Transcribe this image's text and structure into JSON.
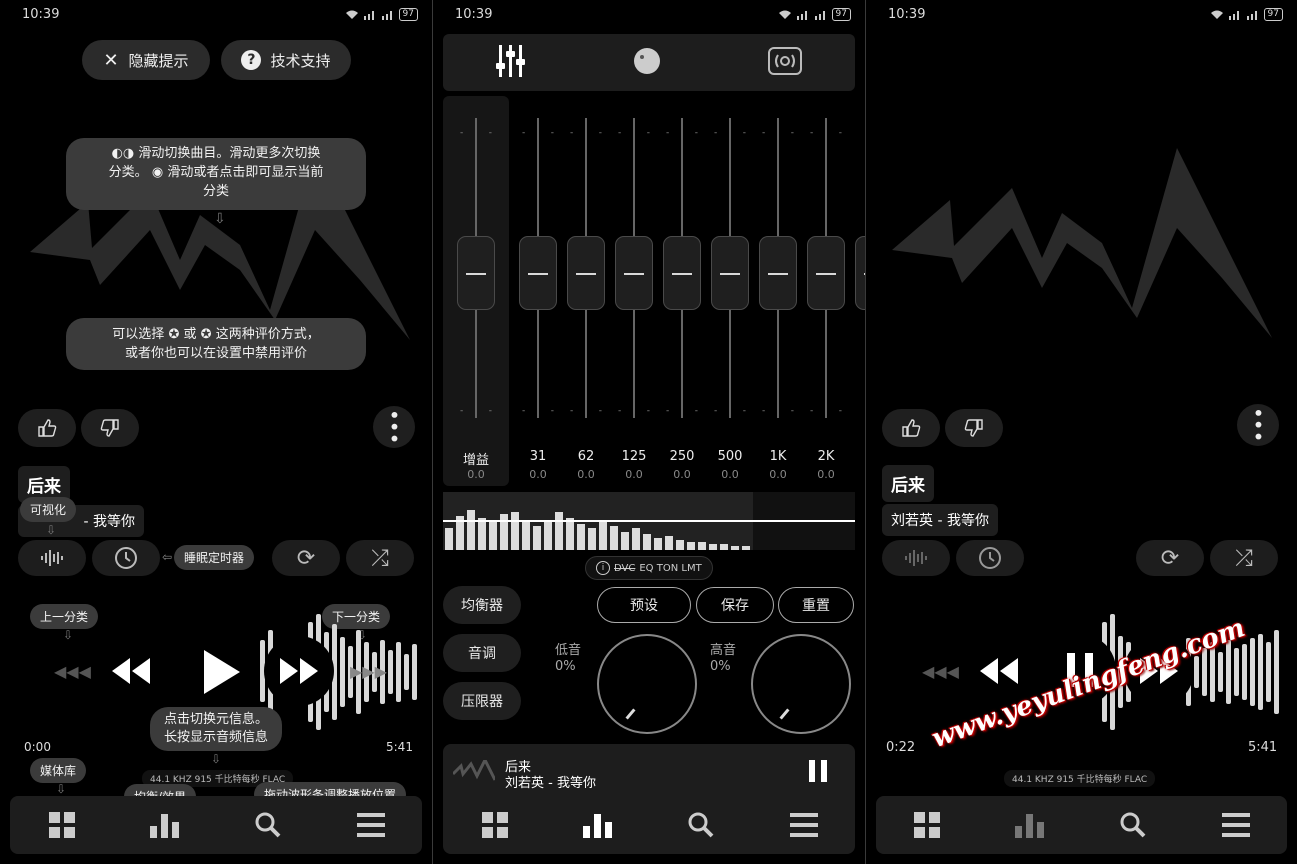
{
  "status": {
    "time": "10:39",
    "battery": "97",
    "net1": "4G",
    "net2": "2G"
  },
  "track": {
    "title": "后来",
    "artist": "刘若英 - 我等你",
    "title_short": "后来",
    "current_left": "0:00",
    "current_right": "0:22",
    "duration": "5:41",
    "meta": "44.1 KHZ  915 千比特每秒  FLAC"
  },
  "hints": {
    "hide": "隐藏提示",
    "support": "技术支持",
    "swipe": "滑动切换曲目。滑动更多次切换分类。 滑动或者点击即可显示当前分类",
    "swipe_l1": "滑动切换曲目。滑动更多次切换",
    "swipe_l2": "分类。",
    "swipe_l3": "滑动或者点击即可显示当前",
    "swipe_l4": "分类",
    "rating_l1": "可以选择",
    "rating_mid": "或",
    "rating_l1b": "这两种评价方式，",
    "rating_l2": "或者你也可以在设置中禁用评价",
    "visual": "可视化",
    "sleep": "睡眠定时器",
    "prev_cat": "上一分类",
    "next_cat": "下一分类",
    "info_l1": "点击切换元信息。",
    "info_l2": "长按显示音频信息",
    "library": "媒体库",
    "eq_effects": "均衡/效果",
    "drag": "拖动波形条调整播放位置",
    "artist_fragment": "- 我等你"
  },
  "eq": {
    "gain_label": "增益",
    "gain_value": "0.0",
    "bands": [
      {
        "label": "31",
        "value": "0.0"
      },
      {
        "label": "62",
        "value": "0.0"
      },
      {
        "label": "125",
        "value": "0.0"
      },
      {
        "label": "250",
        "value": "0.0"
      },
      {
        "label": "500",
        "value": "0.0"
      },
      {
        "label": "1K",
        "value": "0.0"
      },
      {
        "label": "2K",
        "value": "0.0"
      }
    ],
    "dvc_strike": "DVC",
    "dvc_rest": "EQ TON LMT",
    "tab_eq": "均衡器",
    "tab_tone": "音调",
    "tab_limiter": "压限器",
    "preset": "预设",
    "save": "保存",
    "reset": "重置",
    "bass_label": "低音",
    "bass_value": "0%",
    "treble_label": "高音",
    "treble_value": "0%"
  },
  "watermark": "www.yeyulingfeng.com"
}
